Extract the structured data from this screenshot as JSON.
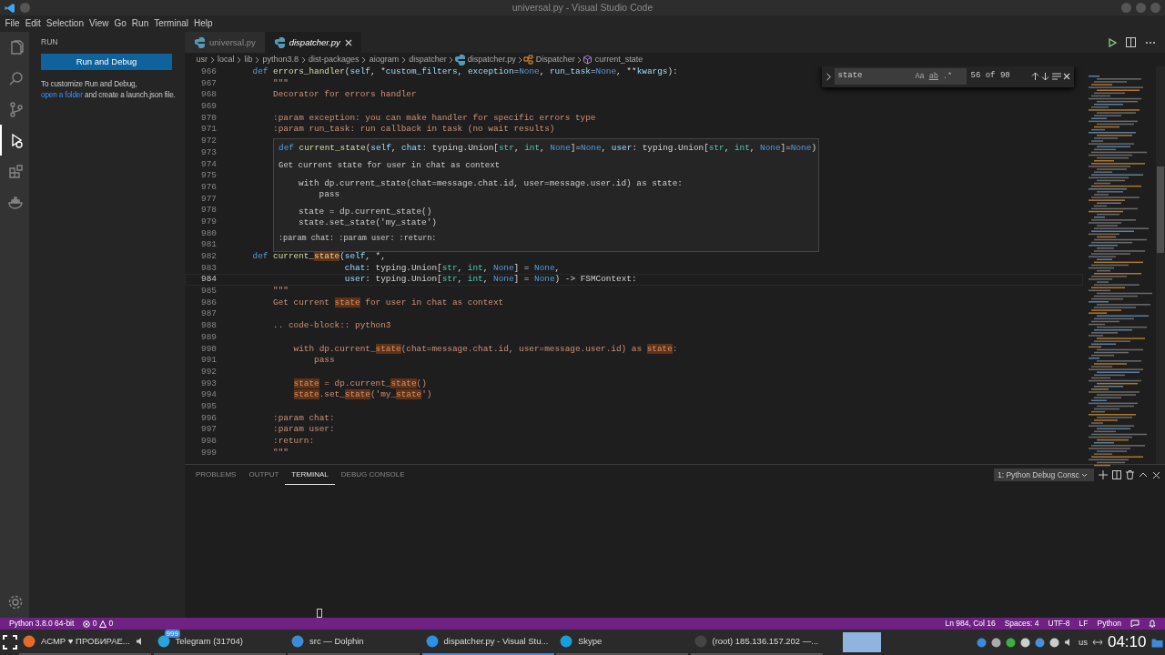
{
  "window": {
    "title": "universal.py - Visual Studio Code"
  },
  "menu": [
    "File",
    "Edit",
    "Selection",
    "View",
    "Go",
    "Run",
    "Terminal",
    "Help"
  ],
  "activity_bar": [
    {
      "kind": "files",
      "selected": false
    },
    {
      "kind": "search",
      "selected": false
    },
    {
      "kind": "source",
      "selected": false
    },
    {
      "kind": "run",
      "selected": true
    },
    {
      "kind": "extensions",
      "selected": false
    },
    {
      "kind": "docker",
      "selected": false
    }
  ],
  "sidebar": {
    "title": "RUN",
    "button": "Run and Debug",
    "text_before": "To customize Run and Debug,",
    "link": "open a folder",
    "text_after": "and create a launch.json file."
  },
  "tabs": [
    {
      "label": "universal.py",
      "selected": false
    },
    {
      "label": "dispatcher.py",
      "selected": true
    }
  ],
  "breadcrumbs": [
    {
      "label": "usr",
      "kind": "folder"
    },
    {
      "label": "local",
      "kind": "folder"
    },
    {
      "label": "lib",
      "kind": "folder"
    },
    {
      "label": "python3.8",
      "kind": "folder"
    },
    {
      "label": "dist-packages",
      "kind": "folder"
    },
    {
      "label": "aiogram",
      "kind": "folder"
    },
    {
      "label": "dispatcher",
      "kind": "folder"
    },
    {
      "label": "dispatcher.py",
      "kind": "file"
    },
    {
      "label": "Dispatcher",
      "kind": "class"
    },
    {
      "label": "current_state",
      "kind": "method"
    }
  ],
  "code": [
    {
      "number": "966",
      "tokens": [
        {
          "text": "    def ",
          "kind": "kw"
        },
        {
          "text": "errors_handler",
          "kind": "fn"
        },
        {
          "text": "(",
          "kind": "plain"
        },
        {
          "text": "self",
          "kind": "param"
        },
        {
          "text": ", *",
          "kind": "plain"
        },
        {
          "text": "custom_filters",
          "kind": "param"
        },
        {
          "text": ", ",
          "kind": "plain"
        },
        {
          "text": "exception",
          "kind": "param"
        },
        {
          "text": "=",
          "kind": "plain"
        },
        {
          "text": "None",
          "kind": "kw"
        },
        {
          "text": ", ",
          "kind": "plain"
        },
        {
          "text": "run_task",
          "kind": "param"
        },
        {
          "text": "=",
          "kind": "plain"
        },
        {
          "text": "None",
          "kind": "kw"
        },
        {
          "text": ", **",
          "kind": "plain"
        },
        {
          "text": "kwargs",
          "kind": "param"
        },
        {
          "text": "):",
          "kind": "plain"
        }
      ]
    },
    {
      "number": "967",
      "tokens": [
        {
          "text": "        \"\"\"",
          "kind": "doc"
        }
      ]
    },
    {
      "number": "968",
      "tokens": [
        {
          "text": "        Decorator for errors handler",
          "kind": "doc"
        }
      ]
    },
    {
      "number": "969"
    },
    {
      "number": "970",
      "tokens": [
        {
          "text": "        :param exception: you can make handler for specific errors type",
          "kind": "doc"
        }
      ]
    },
    {
      "number": "971",
      "tokens": [
        {
          "text": "        :param run_task: run callback in task (no wait results)",
          "kind": "doc"
        }
      ]
    },
    {
      "number": "972"
    },
    {
      "number": "973"
    },
    {
      "number": "974"
    },
    {
      "number": "975"
    },
    {
      "number": "976"
    },
    {
      "number": "977"
    },
    {
      "number": "978"
    },
    {
      "number": "979"
    },
    {
      "number": "980"
    },
    {
      "number": "981"
    },
    {
      "number": "982",
      "tokens": [
        {
          "text": "    def ",
          "kind": "kw"
        },
        {
          "text": "current_",
          "kind": "fn"
        },
        {
          "text": "state",
          "kind": "fn_match"
        },
        {
          "text": "(",
          "kind": "plain"
        },
        {
          "text": "self",
          "kind": "param"
        },
        {
          "text": ", *,",
          "kind": "plain"
        }
      ]
    },
    {
      "number": "983",
      "tokens": [
        {
          "text": "                      chat",
          "kind": "param"
        },
        {
          "text": ": typing.Union[",
          "kind": "plain"
        },
        {
          "text": "str",
          "kind": "type"
        },
        {
          "text": ", ",
          "kind": "plain"
        },
        {
          "text": "int",
          "kind": "type"
        },
        {
          "text": ", ",
          "kind": "plain"
        },
        {
          "text": "None",
          "kind": "kw"
        },
        {
          "text": "] = ",
          "kind": "plain"
        },
        {
          "text": "None",
          "kind": "kw"
        },
        {
          "text": ",",
          "kind": "plain"
        }
      ]
    },
    {
      "number": "984",
      "current": true,
      "tokens": [
        {
          "text": "                      user",
          "kind": "param"
        },
        {
          "text": ": typing.Union[",
          "kind": "plain"
        },
        {
          "text": "str",
          "kind": "type"
        },
        {
          "text": ", ",
          "kind": "plain"
        },
        {
          "text": "int",
          "kind": "type"
        },
        {
          "text": ", ",
          "kind": "plain"
        },
        {
          "text": "None",
          "kind": "kw"
        },
        {
          "text": "] = ",
          "kind": "plain"
        },
        {
          "text": "None",
          "kind": "kw"
        },
        {
          "text": ") -> FSMContext:",
          "kind": "plain"
        }
      ]
    },
    {
      "number": "985",
      "tokens": [
        {
          "text": "        \"\"\"",
          "kind": "doc"
        }
      ]
    },
    {
      "number": "986",
      "tokens": [
        {
          "text": "        Get current ",
          "kind": "doc"
        },
        {
          "text": "state",
          "kind": "match"
        },
        {
          "text": " for user in chat as context",
          "kind": "doc"
        }
      ]
    },
    {
      "number": "987"
    },
    {
      "number": "988",
      "tokens": [
        {
          "text": "        .. code-block:: python3",
          "kind": "doc"
        }
      ]
    },
    {
      "number": "989"
    },
    {
      "number": "990",
      "tokens": [
        {
          "text": "            with dp.current_",
          "kind": "doc"
        },
        {
          "text": "state",
          "kind": "match"
        },
        {
          "text": "(chat=message.chat.id, user=message.user.id) as ",
          "kind": "doc"
        },
        {
          "text": "state",
          "kind": "match"
        },
        {
          "text": ":",
          "kind": "doc"
        }
      ]
    },
    {
      "number": "991",
      "tokens": [
        {
          "text": "                pass",
          "kind": "doc"
        }
      ]
    },
    {
      "number": "992"
    },
    {
      "number": "993",
      "tokens": [
        {
          "text": "            state",
          "kind": "match"
        },
        {
          "text": " = dp.current_",
          "kind": "doc"
        },
        {
          "text": "state",
          "kind": "match"
        },
        {
          "text": "()",
          "kind": "doc"
        }
      ]
    },
    {
      "number": "994",
      "tokens": [
        {
          "text": "            state",
          "kind": "match"
        },
        {
          "text": ".set_",
          "kind": "doc"
        },
        {
          "text": "state",
          "kind": "match"
        },
        {
          "text": "('my_",
          "kind": "doc"
        },
        {
          "text": "state",
          "kind": "match"
        },
        {
          "text": "')",
          "kind": "doc"
        }
      ]
    },
    {
      "number": "995"
    },
    {
      "number": "996",
      "tokens": [
        {
          "text": "        :param chat:",
          "kind": "doc"
        }
      ]
    },
    {
      "number": "997",
      "tokens": [
        {
          "text": "        :param user:",
          "kind": "doc"
        }
      ]
    },
    {
      "number": "998",
      "tokens": [
        {
          "text": "        :return:",
          "kind": "doc"
        }
      ]
    },
    {
      "number": "999",
      "tokens": [
        {
          "text": "        \"\"\"",
          "kind": "doc"
        }
      ]
    }
  ],
  "hover": {
    "signature": [
      {
        "text": "def ",
        "kind": "kw"
      },
      {
        "text": "current_state",
        "kind": "fn"
      },
      {
        "text": "(",
        "kind": "plain"
      },
      {
        "text": "self",
        "kind": "param"
      },
      {
        "text": ", ",
        "kind": "plain"
      },
      {
        "text": "chat",
        "kind": "param"
      },
      {
        "text": ": typing.Union[",
        "kind": "plain"
      },
      {
        "text": "str",
        "kind": "type"
      },
      {
        "text": ", ",
        "kind": "plain"
      },
      {
        "text": "int",
        "kind": "type"
      },
      {
        "text": ", ",
        "kind": "plain"
      },
      {
        "text": "None",
        "kind": "kw"
      },
      {
        "text": "]=",
        "kind": "plain"
      },
      {
        "text": "None",
        "kind": "kw"
      },
      {
        "text": ", ",
        "kind": "plain"
      },
      {
        "text": "user",
        "kind": "param"
      },
      {
        "text": ": typing.Union[",
        "kind": "plain"
      },
      {
        "text": "str",
        "kind": "type"
      },
      {
        "text": ", ",
        "kind": "plain"
      },
      {
        "text": "int",
        "kind": "type"
      },
      {
        "text": ", ",
        "kind": "plain"
      },
      {
        "text": "None",
        "kind": "kw"
      },
      {
        "text": "]=",
        "kind": "plain"
      },
      {
        "text": "None",
        "kind": "kw"
      },
      {
        "text": ")",
        "kind": "plain"
      }
    ],
    "description": "Get current state for user in chat as context",
    "example": [
      [
        "with dp.current_state(chat=message.chat.id, user=message.user.id) as state:",
        "    pass"
      ],
      [
        "state = dp.current_state()",
        "state.set_state('my_state')"
      ]
    ],
    "footer": ":param chat: :param user: :return:"
  },
  "find": {
    "value": "state",
    "case": "Aa",
    "word": "ab",
    "regex": ".*",
    "count": "56 of 90"
  },
  "panel": {
    "tabs": [
      {
        "label": "PROBLEMS",
        "selected": false
      },
      {
        "label": "OUTPUT",
        "selected": false
      },
      {
        "label": "TERMINAL",
        "selected": true
      },
      {
        "label": "DEBUG CONSOLE",
        "selected": false
      }
    ],
    "terminal_select": "1: Python Debug Consc"
  },
  "status_bar": {
    "interpreter": "Python 3.8.0 64-bit",
    "errors": "0",
    "warnings": "0",
    "right": [
      "Ln 984, Col 16",
      "Spaces: 4",
      "UTF-8",
      "LF",
      "Python"
    ]
  },
  "taskbar": {
    "items": [
      {
        "label": "АСМР ♥ ПРОБИРАЕ...",
        "selected": false,
        "kind": "browser"
      },
      {
        "label": "Telegram (31704)",
        "selected": false,
        "kind": "telegram",
        "badge": "999"
      },
      {
        "label": "src — Dolphin",
        "selected": false,
        "kind": "files"
      },
      {
        "label": "dispatcher.py - Visual Stu...",
        "selected": true,
        "kind": "code"
      },
      {
        "label": "Skype",
        "selected": false,
        "kind": "skype"
      },
      {
        "label": "(root) 185.136.157.202 —...",
        "selected": false,
        "kind": "terminal"
      }
    ],
    "layout": "us",
    "clock": "04:10"
  }
}
